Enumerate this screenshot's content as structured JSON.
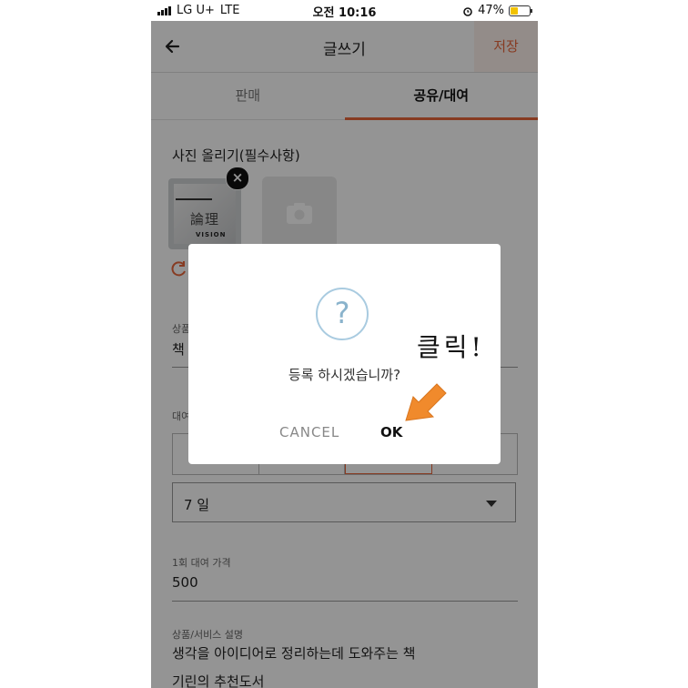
{
  "status_bar": {
    "carrier": "LG U+",
    "network": "LTE",
    "time": "오전 10:16",
    "battery": "47%",
    "battery_level": 0.47
  },
  "header": {
    "title": "글쓰기",
    "save_label": "저장"
  },
  "tabs": [
    {
      "label": "판매",
      "active": false
    },
    {
      "label": "공유/대여",
      "active": true
    }
  ],
  "photo_section": {
    "label": "사진 올리기(필수사항)",
    "thumbnail_text": "論理",
    "thumbnail_subtext": "VISION"
  },
  "fields": {
    "product_label": "상품",
    "product_value": "책",
    "rental_label": "대여",
    "rental_period": "7 일",
    "price_label": "1회 대여 가격",
    "price_value": "500",
    "desc_label": "상품/서비스 설명",
    "desc_line1": "생각을 아이디어로 정리하는데 도와주는 책",
    "desc_line2": "기린의 추천도서"
  },
  "dialog": {
    "message": "등록 하시겠습니까?",
    "cancel_label": "CANCEL",
    "ok_label": "OK",
    "icon": "question-icon"
  },
  "annotation": {
    "text": "클릭!"
  },
  "colors": {
    "accent": "#e8663c",
    "arrow": "#f08a2c",
    "question": "#8ab3cc"
  }
}
